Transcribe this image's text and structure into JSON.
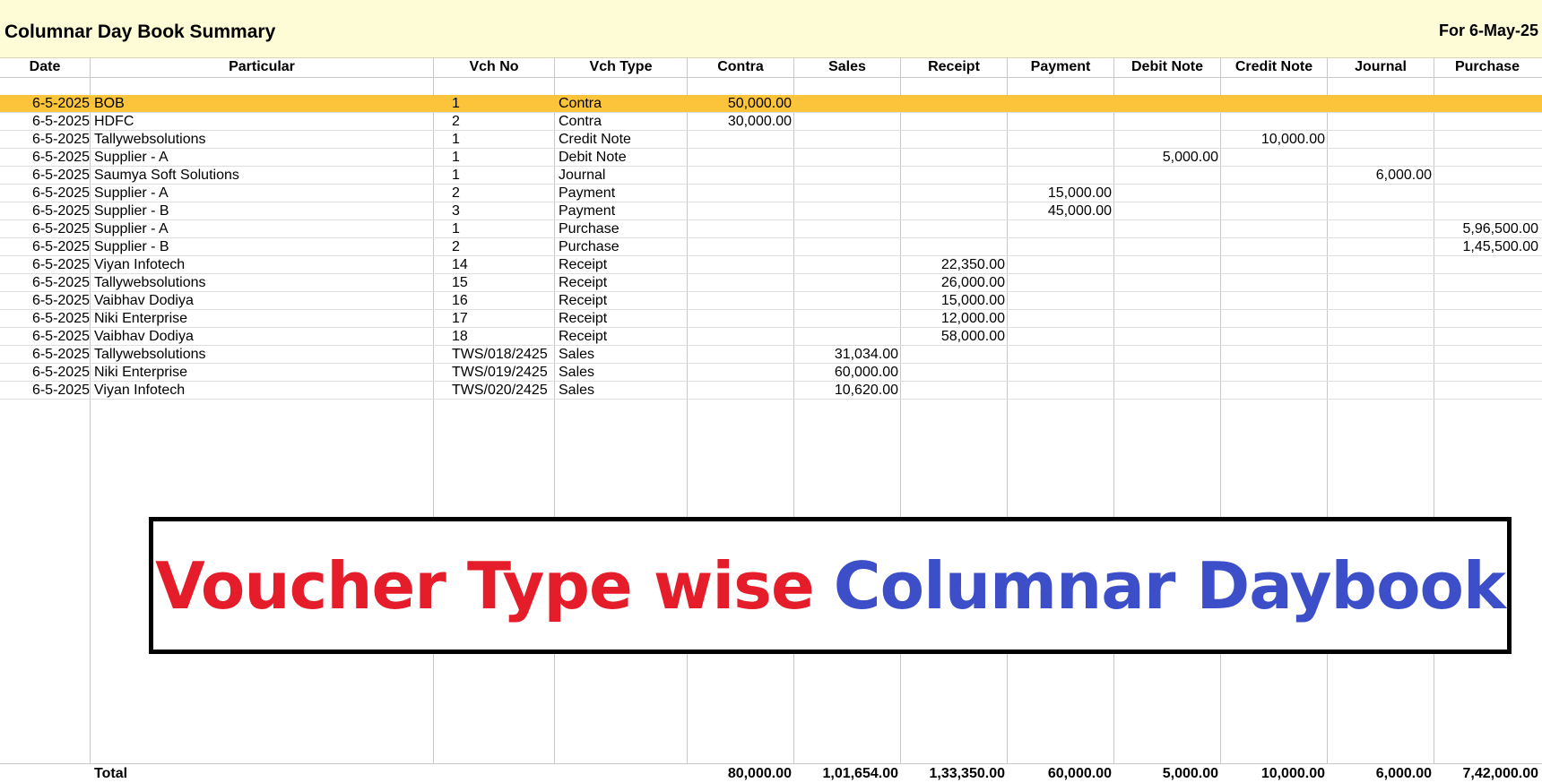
{
  "header": {
    "title": "Columnar Day Book Summary",
    "period": "For 6-May-25"
  },
  "columns": [
    "Date",
    "Particular",
    "Vch No",
    "Vch Type",
    "Contra",
    "Sales",
    "Receipt",
    "Payment",
    "Debit Note",
    "Credit Note",
    "Journal",
    "Purchase"
  ],
  "rows": [
    {
      "date": "6-5-2025",
      "particular": "BOB",
      "vch_no": "1",
      "vch_type": "Contra",
      "contra": "50,000.00",
      "sales": "",
      "receipt": "",
      "payment": "",
      "debit_note": "",
      "credit_note": "",
      "journal": "",
      "purchase": "",
      "selected": true
    },
    {
      "date": "6-5-2025",
      "particular": "HDFC",
      "vch_no": "2",
      "vch_type": "Contra",
      "contra": "30,000.00",
      "sales": "",
      "receipt": "",
      "payment": "",
      "debit_note": "",
      "credit_note": "",
      "journal": "",
      "purchase": ""
    },
    {
      "date": "6-5-2025",
      "particular": "Tallywebsolutions",
      "vch_no": "1",
      "vch_type": "Credit Note",
      "contra": "",
      "sales": "",
      "receipt": "",
      "payment": "",
      "debit_note": "",
      "credit_note": "10,000.00",
      "journal": "",
      "purchase": ""
    },
    {
      "date": "6-5-2025",
      "particular": "Supplier - A",
      "vch_no": "1",
      "vch_type": "Debit Note",
      "contra": "",
      "sales": "",
      "receipt": "",
      "payment": "",
      "debit_note": "5,000.00",
      "credit_note": "",
      "journal": "",
      "purchase": ""
    },
    {
      "date": "6-5-2025",
      "particular": "Saumya Soft Solutions",
      "vch_no": "1",
      "vch_type": "Journal",
      "contra": "",
      "sales": "",
      "receipt": "",
      "payment": "",
      "debit_note": "",
      "credit_note": "",
      "journal": "6,000.00",
      "purchase": ""
    },
    {
      "date": "6-5-2025",
      "particular": "Supplier - A",
      "vch_no": "2",
      "vch_type": "Payment",
      "contra": "",
      "sales": "",
      "receipt": "",
      "payment": "15,000.00",
      "debit_note": "",
      "credit_note": "",
      "journal": "",
      "purchase": ""
    },
    {
      "date": "6-5-2025",
      "particular": "Supplier - B",
      "vch_no": "3",
      "vch_type": "Payment",
      "contra": "",
      "sales": "",
      "receipt": "",
      "payment": "45,000.00",
      "debit_note": "",
      "credit_note": "",
      "journal": "",
      "purchase": ""
    },
    {
      "date": "6-5-2025",
      "particular": "Supplier - A",
      "vch_no": "1",
      "vch_type": "Purchase",
      "contra": "",
      "sales": "",
      "receipt": "",
      "payment": "",
      "debit_note": "",
      "credit_note": "",
      "journal": "",
      "purchase": "5,96,500.00"
    },
    {
      "date": "6-5-2025",
      "particular": "Supplier - B",
      "vch_no": "2",
      "vch_type": "Purchase",
      "contra": "",
      "sales": "",
      "receipt": "",
      "payment": "",
      "debit_note": "",
      "credit_note": "",
      "journal": "",
      "purchase": "1,45,500.00"
    },
    {
      "date": "6-5-2025",
      "particular": "Viyan Infotech",
      "vch_no": "14",
      "vch_type": "Receipt",
      "contra": "",
      "sales": "",
      "receipt": "22,350.00",
      "payment": "",
      "debit_note": "",
      "credit_note": "",
      "journal": "",
      "purchase": ""
    },
    {
      "date": "6-5-2025",
      "particular": "Tallywebsolutions",
      "vch_no": "15",
      "vch_type": "Receipt",
      "contra": "",
      "sales": "",
      "receipt": "26,000.00",
      "payment": "",
      "debit_note": "",
      "credit_note": "",
      "journal": "",
      "purchase": ""
    },
    {
      "date": "6-5-2025",
      "particular": "Vaibhav Dodiya",
      "vch_no": "16",
      "vch_type": "Receipt",
      "contra": "",
      "sales": "",
      "receipt": "15,000.00",
      "payment": "",
      "debit_note": "",
      "credit_note": "",
      "journal": "",
      "purchase": ""
    },
    {
      "date": "6-5-2025",
      "particular": "Niki Enterprise",
      "vch_no": "17",
      "vch_type": "Receipt",
      "contra": "",
      "sales": "",
      "receipt": "12,000.00",
      "payment": "",
      "debit_note": "",
      "credit_note": "",
      "journal": "",
      "purchase": ""
    },
    {
      "date": "6-5-2025",
      "particular": "Vaibhav Dodiya",
      "vch_no": "18",
      "vch_type": "Receipt",
      "contra": "",
      "sales": "",
      "receipt": "58,000.00",
      "payment": "",
      "debit_note": "",
      "credit_note": "",
      "journal": "",
      "purchase": ""
    },
    {
      "date": "6-5-2025",
      "particular": "Tallywebsolutions",
      "vch_no": "TWS/018/2425",
      "vch_type": "Sales",
      "contra": "",
      "sales": "31,034.00",
      "receipt": "",
      "payment": "",
      "debit_note": "",
      "credit_note": "",
      "journal": "",
      "purchase": ""
    },
    {
      "date": "6-5-2025",
      "particular": "Niki Enterprise",
      "vch_no": "TWS/019/2425",
      "vch_type": "Sales",
      "contra": "",
      "sales": "60,000.00",
      "receipt": "",
      "payment": "",
      "debit_note": "",
      "credit_note": "",
      "journal": "",
      "purchase": ""
    },
    {
      "date": "6-5-2025",
      "particular": "Viyan Infotech",
      "vch_no": "TWS/020/2425",
      "vch_type": "Sales",
      "contra": "",
      "sales": "10,620.00",
      "receipt": "",
      "payment": "",
      "debit_note": "",
      "credit_note": "",
      "journal": "",
      "purchase": ""
    }
  ],
  "totals": {
    "label": "Total",
    "contra": "80,000.00",
    "sales": "1,01,654.00",
    "receipt": "1,33,350.00",
    "payment": "60,000.00",
    "debit_note": "5,000.00",
    "credit_note": "10,000.00",
    "journal": "6,000.00",
    "purchase": "7,42,000.00"
  },
  "banner": {
    "part1": "Voucher Type wise",
    "part2": "Columnar Daybook",
    "color1": "#e51d2a",
    "color2": "#3c4fc9"
  },
  "colors": {
    "header_bg": "#fefcd6",
    "selected_row": "#fbc43a"
  }
}
